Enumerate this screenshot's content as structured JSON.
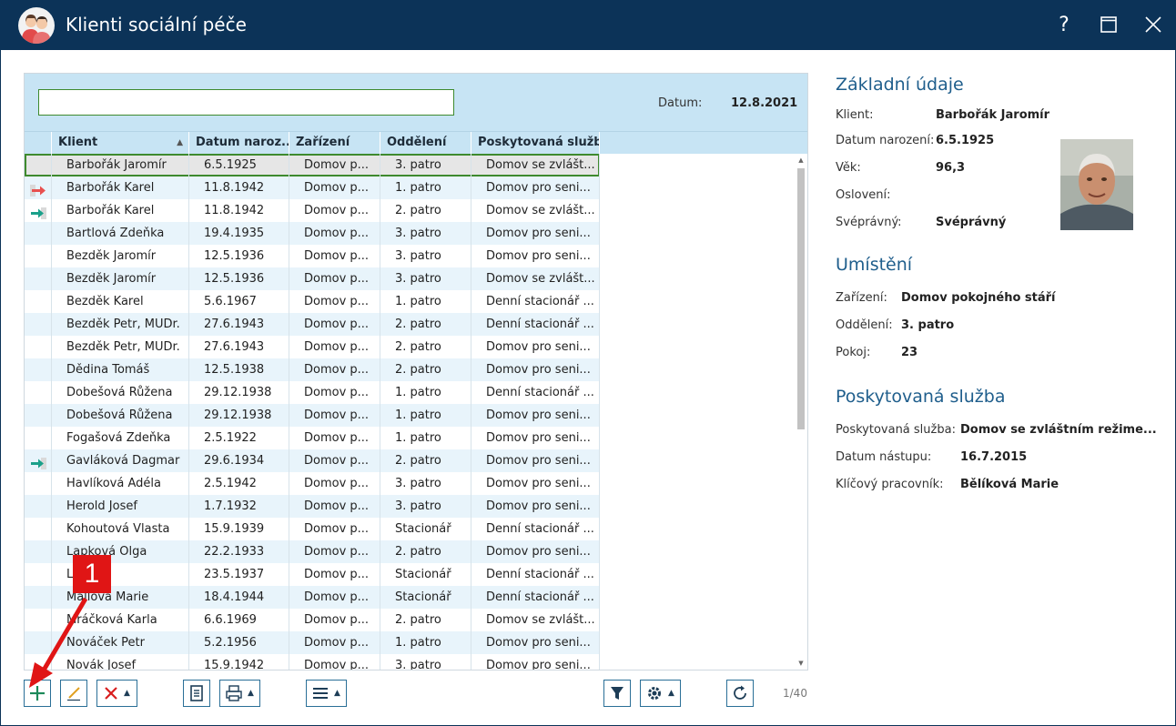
{
  "window": {
    "title": "Klienti sociální péče",
    "help_glyph": "?",
    "icons": [
      "help-icon",
      "maximize-icon",
      "close-icon"
    ]
  },
  "filter": {
    "search_value": "",
    "date_label": "Datum:",
    "date_value": "12.8.2021"
  },
  "grid": {
    "columns": [
      "Klient",
      "Datum naroz...",
      "Zařízení",
      "Oddělení",
      "Poskytovaná služba"
    ],
    "rows": [
      {
        "icon": "",
        "name": "Barbořák Jaromír",
        "dob": "6.5.1925",
        "facility": "Domov p...",
        "dept": "3. patro",
        "service": "Domov se zvlášt..."
      },
      {
        "icon": "arrow-out-icon",
        "name": "Barbořák Karel",
        "dob": "11.8.1942",
        "facility": "Domov p...",
        "dept": "1. patro",
        "service": "Domov pro seni..."
      },
      {
        "icon": "arrow-in-icon",
        "name": "Barbořák Karel",
        "dob": "11.8.1942",
        "facility": "Domov p...",
        "dept": "2. patro",
        "service": "Domov se zvlášt..."
      },
      {
        "icon": "",
        "name": "Bartlová Zdeňka",
        "dob": "19.4.1935",
        "facility": "Domov p...",
        "dept": "3. patro",
        "service": "Domov pro seni..."
      },
      {
        "icon": "",
        "name": "Bezděk Jaromír",
        "dob": "12.5.1936",
        "facility": "Domov p...",
        "dept": "3. patro",
        "service": "Domov pro seni..."
      },
      {
        "icon": "",
        "name": "Bezděk Jaromír",
        "dob": "12.5.1936",
        "facility": "Domov p...",
        "dept": "3. patro",
        "service": "Domov se zvlášt..."
      },
      {
        "icon": "",
        "name": "Bezděk Karel",
        "dob": "5.6.1967",
        "facility": "Domov p...",
        "dept": "1. patro",
        "service": "Denní stacionář ..."
      },
      {
        "icon": "",
        "name": "Bezděk Petr, MUDr.",
        "dob": "27.6.1943",
        "facility": "Domov p...",
        "dept": "2. patro",
        "service": "Denní stacionář ..."
      },
      {
        "icon": "",
        "name": "Bezděk Petr, MUDr.",
        "dob": "27.6.1943",
        "facility": "Domov p...",
        "dept": "2. patro",
        "service": "Domov pro seni..."
      },
      {
        "icon": "",
        "name": "Dědina Tomáš",
        "dob": "12.5.1938",
        "facility": "Domov p...",
        "dept": "2. patro",
        "service": "Domov pro seni..."
      },
      {
        "icon": "",
        "name": "Dobešová Růžena",
        "dob": "29.12.1938",
        "facility": "Domov p...",
        "dept": "1. patro",
        "service": "Denní stacionář ..."
      },
      {
        "icon": "",
        "name": "Dobešová Růžena",
        "dob": "29.12.1938",
        "facility": "Domov p...",
        "dept": "1. patro",
        "service": "Domov pro seni..."
      },
      {
        "icon": "",
        "name": "Fogašová Zdeňka",
        "dob": "2.5.1922",
        "facility": "Domov p...",
        "dept": "1. patro",
        "service": "Domov pro seni..."
      },
      {
        "icon": "arrow-in-icon",
        "name": "Gavláková Dagmar",
        "dob": "29.6.1934",
        "facility": "Domov p...",
        "dept": "2. patro",
        "service": "Domov pro seni..."
      },
      {
        "icon": "",
        "name": "Havlíková Adéla",
        "dob": "2.5.1942",
        "facility": "Domov p...",
        "dept": "3. patro",
        "service": "Domov pro seni..."
      },
      {
        "icon": "",
        "name": "Herold Josef",
        "dob": "1.7.1932",
        "facility": "Domov p...",
        "dept": "3. patro",
        "service": "Domov pro seni..."
      },
      {
        "icon": "",
        "name": "Kohoutová Vlasta",
        "dob": "15.9.1939",
        "facility": "Domov p...",
        "dept": "Stacionář",
        "service": "Denní stacionář ..."
      },
      {
        "icon": "",
        "name": "Lapková Olga",
        "dob": "22.2.1933",
        "facility": "Domov p...",
        "dept": "2. patro",
        "service": "Domov pro seni..."
      },
      {
        "icon": "",
        "name": "Li   niel",
        "dob": "23.5.1937",
        "facility": "Domov p...",
        "dept": "Stacionář",
        "service": "Denní stacionář ..."
      },
      {
        "icon": "",
        "name": "Mallova Marie",
        "dob": "18.4.1944",
        "facility": "Domov p...",
        "dept": "Stacionář",
        "service": "Denní stacionář ..."
      },
      {
        "icon": "",
        "name": "Mráčková Karla",
        "dob": "6.6.1969",
        "facility": "Domov p...",
        "dept": "2. patro",
        "service": "Domov se zvlášt..."
      },
      {
        "icon": "",
        "name": "Nováček Petr",
        "dob": "5.2.1956",
        "facility": "Domov p...",
        "dept": "1. patro",
        "service": "Domov pro seni..."
      },
      {
        "icon": "",
        "name": "Novák Josef",
        "dob": "15.9.1942",
        "facility": "Domov p...",
        "dept": "3. patro",
        "service": "Domov pro seni..."
      }
    ],
    "selected_row": 0,
    "page_count": "1/40"
  },
  "toolbar": {
    "icons": [
      "add-icon",
      "edit-icon",
      "delete-icon",
      "document-icon",
      "print-icon",
      "menu-icon",
      "filter-icon",
      "settings-icon",
      "refresh-icon"
    ]
  },
  "details": {
    "basic": {
      "title": "Základní údaje",
      "client_label": "Klient:",
      "client_value": "Barbořák Jaromír",
      "dob_label": "Datum narození:",
      "dob_value": "6.5.1925",
      "age_label": "Věk:",
      "age_value": "96,3",
      "salutation_label": "Oslovení:",
      "salutation_value": "",
      "competent_label": "Svéprávný:",
      "competent_value": "Svéprávný"
    },
    "placement": {
      "title": "Umístění",
      "facility_label": "Zařízení:",
      "facility_value": "Domov pokojného stáří",
      "dept_label": "Oddělení:",
      "dept_value": "3. patro",
      "room_label": "Pokoj:",
      "room_value": "23"
    },
    "service": {
      "title": "Poskytovaná služba",
      "service_label": "Poskytovaná služba:",
      "service_value": "Domov se zvláštním režime...",
      "start_label": "Datum nástupu:",
      "start_value": "16.7.2015",
      "worker_label": "Klíčový pracovník:",
      "worker_value": "Bělíková Marie"
    }
  },
  "annotation": {
    "badge": "1"
  },
  "colors": {
    "titlebar": "#0c3358",
    "grid_header": "#c7e4f4",
    "row_alt": "#e8f4fb",
    "selection_border": "#3e8a2e",
    "section_title": "#1f5e8c",
    "annotation_red": "#e01515"
  }
}
